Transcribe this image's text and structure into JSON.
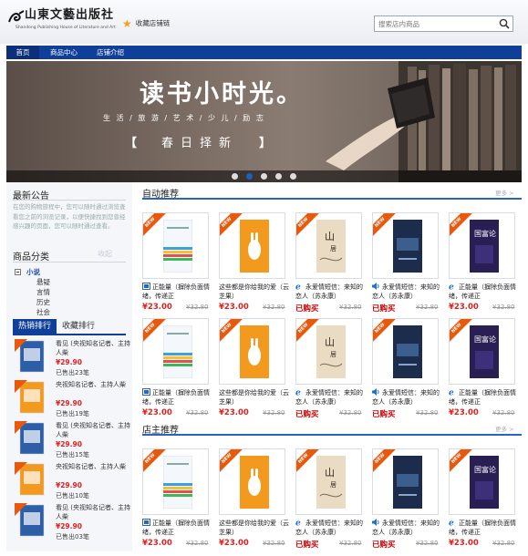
{
  "header": {
    "logo_cn": "山東文藝出版社",
    "logo_en": "Shandong Publishing House of Literature and Art",
    "favorite_label": "收藏店铺链",
    "search_placeholder": "搜索店内商品"
  },
  "nav": {
    "items": [
      "首页",
      "商品中心",
      "店铺介绍"
    ],
    "active": 0
  },
  "banner": {
    "title": "读书小时光。",
    "subtitle": "生 活 / 旅 游 / 艺 术 / 少 儿 / 励 志",
    "tag_left": "【",
    "tag_text": "春日择新",
    "tag_right": "】",
    "slides": 5,
    "active_slide": 1
  },
  "sidebar": {
    "notice_title": "最新公告",
    "notice_text": "在您的购物旅程中，您可以随时通过浏览查看您之前的浏览记录，以便快捷找到您曾经感兴趣的页面，您可以随时通过查看。",
    "category_title": "商品分类",
    "category_hint": "收起",
    "category_root": "小说",
    "category_children": [
      "悬疑",
      "言情",
      "历史",
      "社会"
    ],
    "tab_hot": "热销排行",
    "tab_fav": "收藏排行",
    "ranking": [
      {
        "title": "看见 (央视知名记者、主持人柴",
        "price": "¥29.90",
        "sold": "已售出23笔"
      },
      {
        "title": "央视知名记者、主持人柴",
        "price": "¥29.90",
        "sold": "已售出19笔"
      },
      {
        "title": "看见 (央视知名记者、主持人柴",
        "price": "¥29.90",
        "sold": "已售出15笔"
      },
      {
        "title": "央视知名记者、主持人柴",
        "price": "¥29.90",
        "sold": "已售出10笔"
      },
      {
        "title": "看见 (央视知名记者、主持人柴",
        "price": "¥29.90",
        "sold": "已售出03笔"
      }
    ]
  },
  "sections": [
    {
      "title": "自动推荐",
      "more": "更多 >"
    },
    {
      "title": "店主推荐",
      "more": "更多 >"
    }
  ],
  "products": [
    {
      "name": "正能量（摒除负面情绪，传递正",
      "price": "¥23.00",
      "old": "¥32.80",
      "icon": "film-icon",
      "cover": "white"
    },
    {
      "name": "这些都是你给我的爱（云芝果）",
      "price": "¥23.00",
      "old": "¥32.80",
      "icon": "",
      "cover": "orange"
    },
    {
      "name": "永爱情短信：来知的恋人（苏永康）",
      "price": "已购买",
      "old": "¥32.80",
      "icon": "ie-icon",
      "cover": "beige"
    },
    {
      "name": "永爱情短信：来知的恋人（苏永康）",
      "price": "已购买",
      "old": "¥32.80",
      "icon": "speaker-icon",
      "cover": "navy"
    },
    {
      "name": "正能量（摒除负面情绪，传递正",
      "price": "¥23.00",
      "old": "¥32.80",
      "icon": "ie-icon",
      "cover": "purple"
    }
  ],
  "ribbon_label": "NEW",
  "colors": {
    "brand": "#0f3f99",
    "price": "#dd2222",
    "ribbon": "#e8590c"
  }
}
